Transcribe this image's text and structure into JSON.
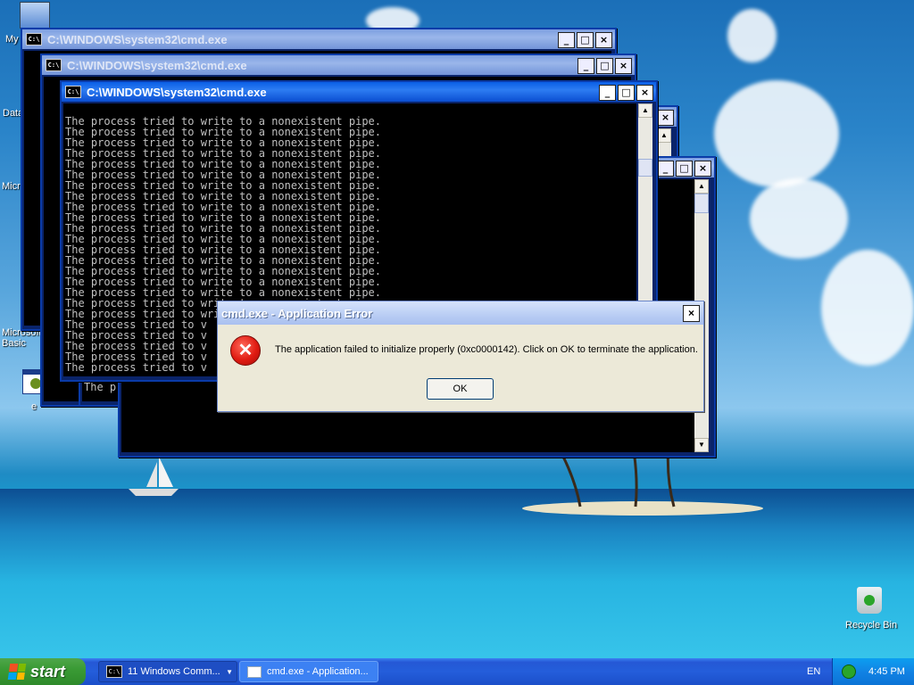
{
  "desktop": {
    "icon_labels": [
      "My",
      "Data",
      "Microso",
      "Microsoft Basic",
      "e"
    ],
    "recycle_bin_label": "Recycle Bin"
  },
  "windows": {
    "w1_title": "C:\\WINDOWS\\system32\\cmd.exe",
    "w2_title": "C:\\WINDOWS\\system32\\cmd.exe",
    "w3_title": "C:\\WINDOWS\\system32\\cmd.exe",
    "line": "The process tried to write to a nonexistent pipe.",
    "partial_line": "The process tried to v",
    "partial_short": "The p"
  },
  "dialog": {
    "title": "cmd.exe - Application Error",
    "message": "The application failed to initialize properly (0xc0000142). Click on OK to terminate the application.",
    "ok_label": "OK"
  },
  "taskbar": {
    "start_label": "start",
    "group_label": "11 Windows Comm...",
    "active_label": "cmd.exe - Application...",
    "language": "EN",
    "clock": "4:45 PM"
  },
  "colors": {
    "console_bg": "#000000",
    "console_text": "#c0c0c0",
    "titlebar_active": "#0a5fe6",
    "dialog_bg": "#ece9d8"
  }
}
